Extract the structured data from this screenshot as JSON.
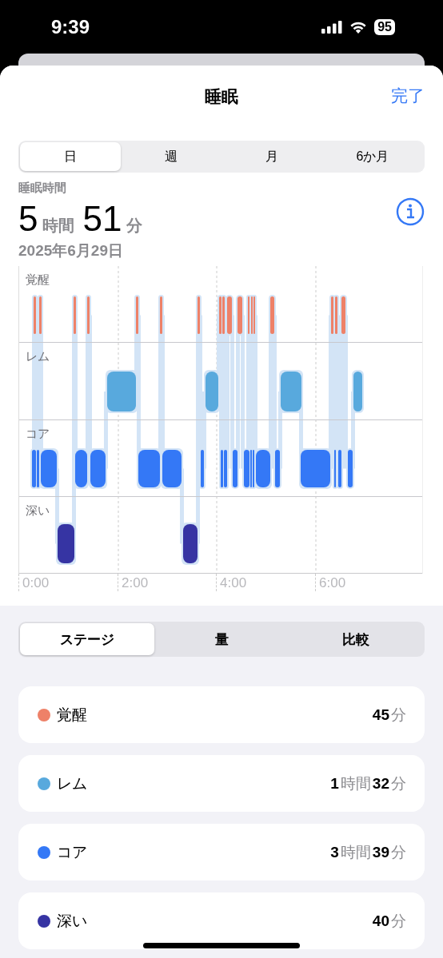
{
  "status_bar": {
    "time": "9:39",
    "battery": "95"
  },
  "header": {
    "title": "睡眠",
    "done": "完了"
  },
  "period_tabs": [
    {
      "label": "日",
      "selected": true
    },
    {
      "label": "週",
      "selected": false
    },
    {
      "label": "月",
      "selected": false
    },
    {
      "label": "6か月",
      "selected": false
    }
  ],
  "summary": {
    "label": "睡眠時間",
    "total": [
      {
        "text": "5",
        "kind": "number"
      },
      {
        "text": "時間",
        "kind": "unit"
      },
      {
        "text": "51",
        "kind": "number"
      },
      {
        "text": "分",
        "kind": "unit"
      }
    ],
    "date": "2025年6月29日"
  },
  "chart": {
    "stage_labels": [
      "覚醒",
      "レム",
      "コア",
      "深い"
    ],
    "time_labels": [
      "0:00",
      "2:00",
      "4:00",
      "6:00"
    ]
  },
  "view_tabs": [
    {
      "label": "ステージ",
      "selected": true
    },
    {
      "label": "量",
      "selected": false
    },
    {
      "label": "比較",
      "selected": false
    }
  ],
  "stages": [
    {
      "name": "覚醒",
      "color": "#ee8168",
      "duration": [
        {
          "text": "45",
          "kind": "number"
        },
        {
          "text": "分",
          "kind": "unit"
        }
      ]
    },
    {
      "name": "レム",
      "color": "#58a9dd",
      "duration": [
        {
          "text": "1",
          "kind": "number"
        },
        {
          "text": "時間",
          "kind": "unit"
        },
        {
          "text": "32",
          "kind": "number"
        },
        {
          "text": "分",
          "kind": "unit"
        }
      ]
    },
    {
      "name": "コア",
      "color": "#3478f6",
      "duration": [
        {
          "text": "3",
          "kind": "number"
        },
        {
          "text": "時間",
          "kind": "unit"
        },
        {
          "text": "39",
          "kind": "number"
        },
        {
          "text": "分",
          "kind": "unit"
        }
      ]
    },
    {
      "name": "深い",
      "color": "#3634a3",
      "duration": [
        {
          "text": "40",
          "kind": "number"
        },
        {
          "text": "分",
          "kind": "unit"
        }
      ]
    }
  ]
}
